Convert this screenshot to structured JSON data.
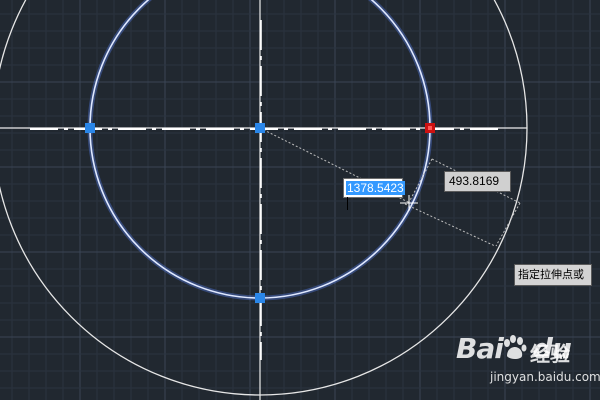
{
  "canvas": {
    "background": "#212830",
    "grid_color": "#2f3947",
    "accent_circle_color": "#4a78ff",
    "grip_color": "#2a86e8",
    "hot_grip_color": "#cc1111",
    "crosshair_color": "#e8e8e8"
  },
  "dynamic_input": {
    "value": "1378.5423"
  },
  "dimension": {
    "value": "493.8169"
  },
  "tooltip": {
    "text": "指定拉伸点或"
  },
  "watermark": {
    "brand": "Bai",
    "brand_suffix": "du",
    "product": "经验",
    "url": "jingyan.baidu.com"
  }
}
